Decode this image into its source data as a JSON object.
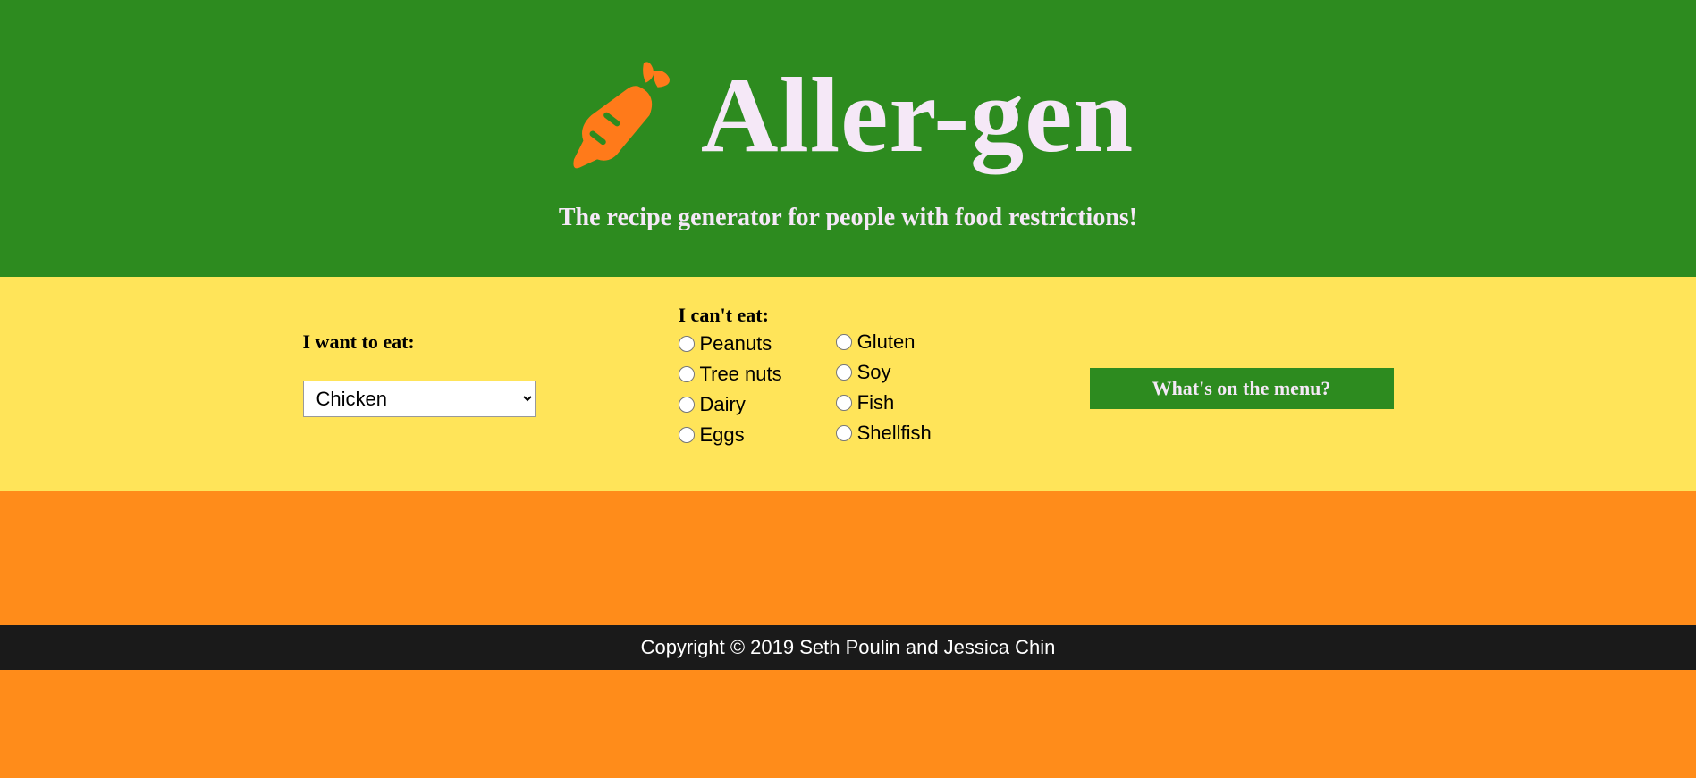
{
  "header": {
    "title": "Aller-gen",
    "tagline": "The recipe generator for people with food restrictions!"
  },
  "form": {
    "eat_label": "I want to eat:",
    "eat_selected": "Chicken",
    "restrictions_label": "I can't eat:",
    "restrictions_col1": [
      "Peanuts",
      "Tree nuts",
      "Dairy",
      "Eggs"
    ],
    "restrictions_col2": [
      "Gluten",
      "Soy",
      "Fish",
      "Shellfish"
    ],
    "button_label": "What's on the menu?"
  },
  "footer": {
    "copyright": "Copyright © 2019 Seth Poulin and Jessica Chin"
  }
}
